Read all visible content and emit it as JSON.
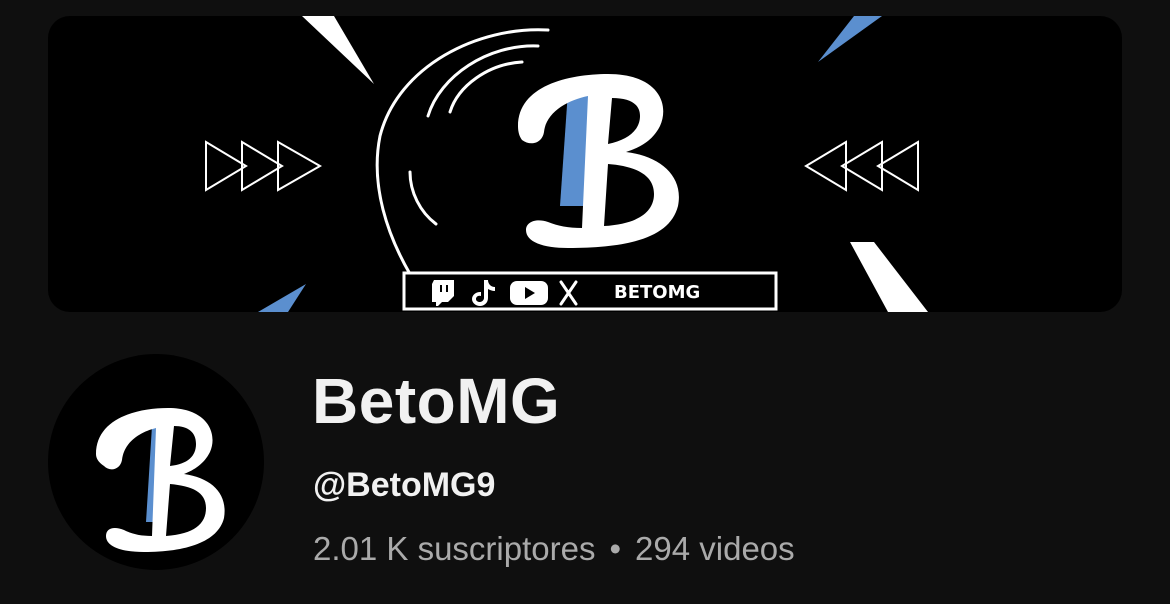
{
  "channel": {
    "name": "BetoMG",
    "handle": "@BetoMG9",
    "subscribers": "2.01 K suscriptores",
    "separator": "•",
    "videos": "294 videos"
  },
  "banner": {
    "logo_letter": "B",
    "social_label": "BETOMG",
    "social_icons": [
      "twitch-icon",
      "tiktok-icon",
      "youtube-icon",
      "x-icon"
    ]
  },
  "avatar": {
    "logo_letter": "B"
  },
  "colors": {
    "background": "#0f0f0f",
    "banner_background": "#000000",
    "accent_blue": "#5b8fcf",
    "text_primary": "#f1f1f1",
    "text_secondary": "#aaaaaa"
  }
}
